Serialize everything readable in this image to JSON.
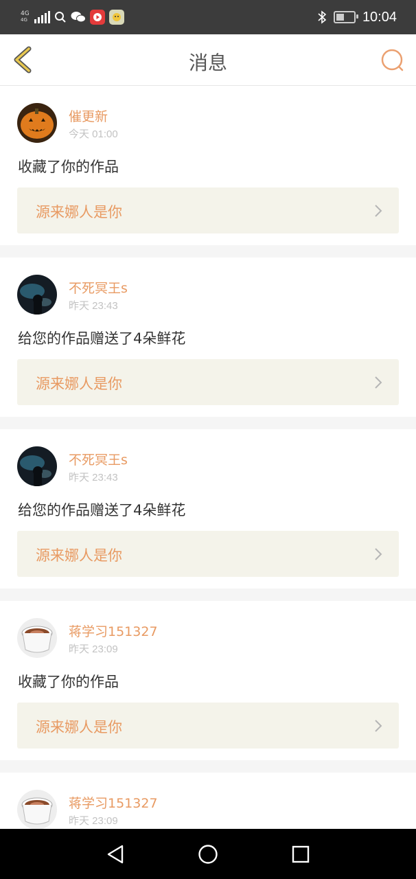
{
  "status_bar": {
    "network": "4G",
    "network_sub": "4G",
    "time": "10:04",
    "battery_level": 0.45,
    "icons": [
      "signal-icon",
      "search-icon",
      "wechat-icon",
      "video-app-icon",
      "sticker-app-icon",
      "bluetooth-icon",
      "battery-icon"
    ]
  },
  "header": {
    "title": "消息",
    "back_icon": "chevron-left-icon",
    "search_icon": "search-icon",
    "accent_color": "#e89a62",
    "back_color": "#d7b54a"
  },
  "messages": [
    {
      "user": "催更新",
      "time": "今天 01:00",
      "text": "收藏了你的作品",
      "work_title": "源来娜人是你",
      "avatar": "pumpkin"
    },
    {
      "user": "不死冥王s",
      "time": "昨天 23:43",
      "text": "给您的作品赠送了4朵鲜花",
      "work_title": "源来娜人是你",
      "avatar": "dark"
    },
    {
      "user": "不死冥王s",
      "time": "昨天 23:43",
      "text": "给您的作品赠送了4朵鲜花",
      "work_title": "源来娜人是你",
      "avatar": "dark"
    },
    {
      "user": "蒋学习151327",
      "time": "昨天 23:09",
      "text": "收藏了你的作品",
      "work_title": "源来娜人是你",
      "avatar": "coffee"
    },
    {
      "user": "蒋学习151327",
      "time": "昨天 23:09",
      "text": "",
      "work_title": "",
      "avatar": "coffee"
    }
  ],
  "system_nav": {
    "back_icon": "triangle-back-icon",
    "home_icon": "circle-home-icon",
    "recents_icon": "square-recents-icon"
  }
}
